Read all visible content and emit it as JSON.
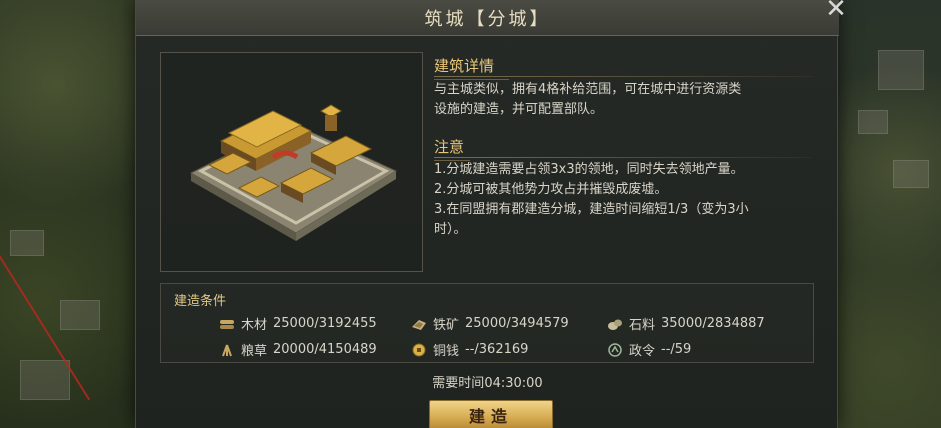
{
  "dialog": {
    "title": "筑城【分城】",
    "close_icon": "close-x-icon"
  },
  "details": {
    "heading": "建筑详情",
    "line1": "与主城类似，拥有4格补给范围，可在城中进行资源类",
    "line2": "设施的建造，并可配置部队。"
  },
  "notes": {
    "heading": "注意",
    "line1": "1.分城建造需要占领3x3的领地，同时失去领地产量。",
    "line2": "2.分城可被其他势力攻占并摧毁成废墟。",
    "line3": "3.在同盟拥有郡建造分城，建造时间缩短1/3（变为3小",
    "line4": "时）。"
  },
  "conditions": {
    "heading": "建造条件",
    "wood": {
      "name": "木材",
      "value": "25000/3192455",
      "icon": "wood-icon"
    },
    "iron": {
      "name": "铁矿",
      "value": "25000/3494579",
      "icon": "iron-ore-icon"
    },
    "stone": {
      "name": "石料",
      "value": "35000/2834887",
      "icon": "stone-icon"
    },
    "grain": {
      "name": "粮草",
      "value": "20000/4150489",
      "icon": "grain-icon"
    },
    "copper": {
      "name": "铜钱",
      "value": "--/362169",
      "icon": "copper-coin-icon"
    },
    "order": {
      "name": "政令",
      "value": "--/59",
      "icon": "decree-icon"
    }
  },
  "time": {
    "label": "需要时间",
    "value": "04:30:00"
  },
  "build_button": {
    "label": "建造"
  },
  "colors": {
    "accent_gold": "#e8c77a",
    "button_gold": "#d8ae55",
    "text": "#d8d4c8"
  }
}
